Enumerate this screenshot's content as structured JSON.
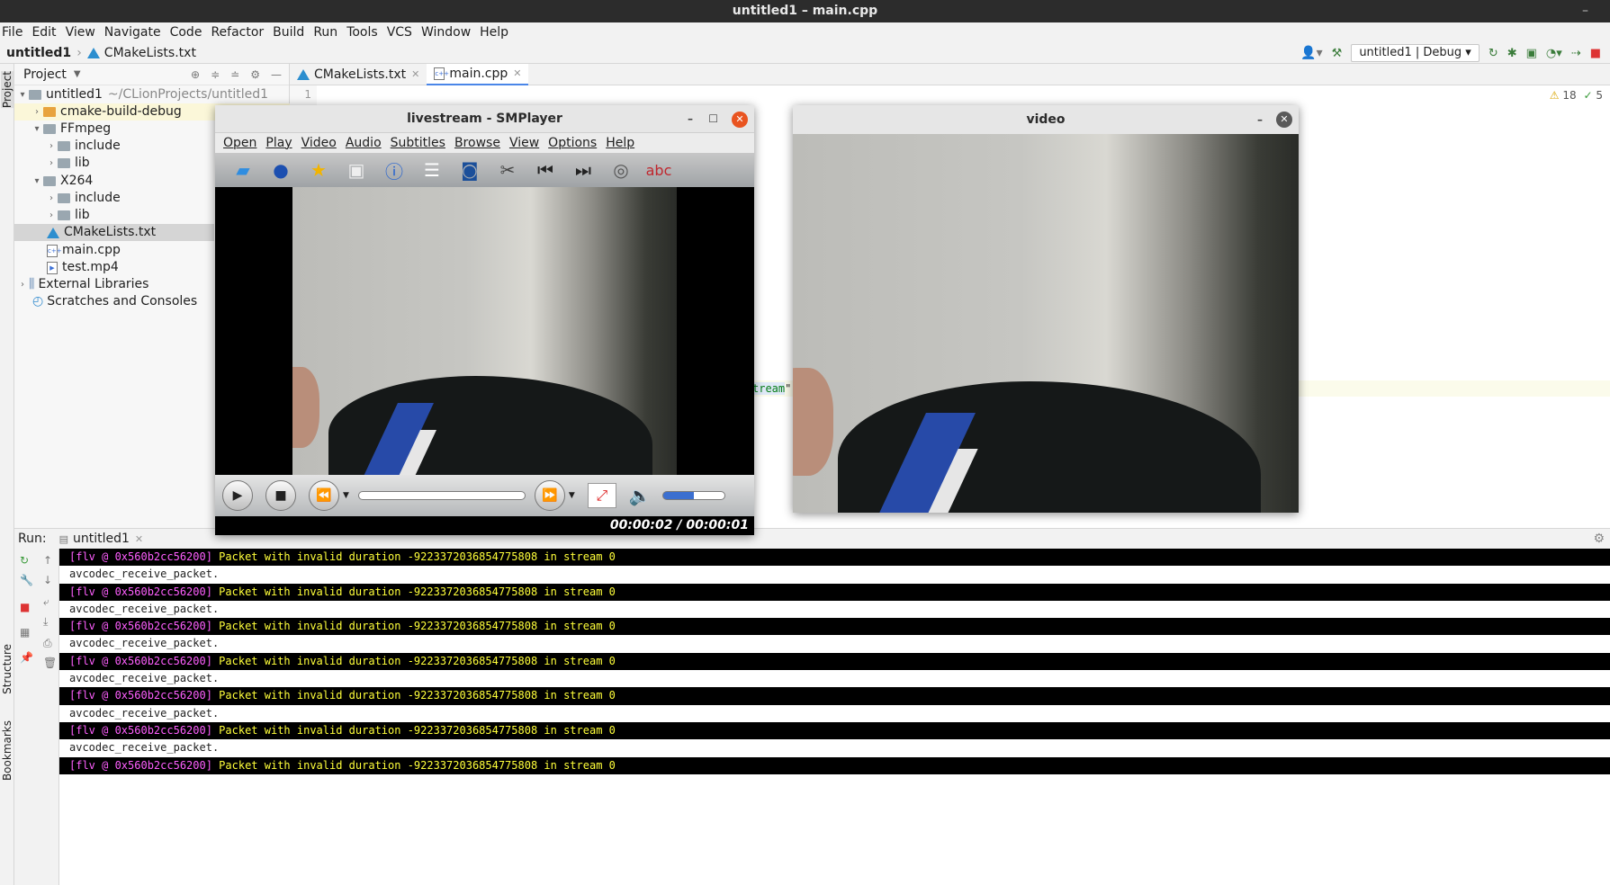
{
  "window_title": "untitled1 – main.cpp",
  "menu": [
    "File",
    "Edit",
    "View",
    "Navigate",
    "Code",
    "Refactor",
    "Build",
    "Run",
    "Tools",
    "VCS",
    "Window",
    "Help"
  ],
  "breadcrumb": {
    "project": "untitled1",
    "file": "CMakeLists.txt"
  },
  "run_config": "untitled1 | Debug",
  "project_panel": {
    "title": "Project",
    "root": {
      "name": "untitled1",
      "path": "~/CLionProjects/untitled1"
    },
    "items": [
      "cmake-build-debug",
      "FFmpeg",
      "include",
      "lib",
      "X264",
      "include",
      "lib",
      "CMakeLists.txt",
      "main.cpp",
      "test.mp4",
      "External Libraries",
      "Scratches and Consoles"
    ]
  },
  "editor_tabs": [
    "CMakeLists.txt",
    "main.cpp"
  ],
  "editor": {
    "line_number": "1",
    "code_fragment": "tream",
    "code_suffix": "\";",
    "inspection_warnings": "18",
    "inspection_ok": "5"
  },
  "side_labels": {
    "project": "Project",
    "structure": "Structure",
    "bookmarks": "Bookmarks"
  },
  "run_panel": {
    "label": "Run:",
    "tab": "untitled1",
    "log_error_prefix": "[flv @ 0x560b2cc56200]",
    "log_error_msg": " Packet with invalid duration -9223372036854775808 in stream 0",
    "log_info": "avcodec_receive_packet."
  },
  "smplayer": {
    "title": "livestream - SMPlayer",
    "menu": [
      "Open",
      "Play",
      "Video",
      "Audio",
      "Subtitles",
      "Browse",
      "View",
      "Options",
      "Help"
    ],
    "time": "00:00:02 / 00:00:01"
  },
  "video_window": {
    "title": "video"
  },
  "colors": {
    "accent": "#4a86e8",
    "close": "#e95420",
    "console_err_bg": "#000000",
    "console_err_fg": "#ffff3a",
    "console_tag": "#ff5fff"
  }
}
